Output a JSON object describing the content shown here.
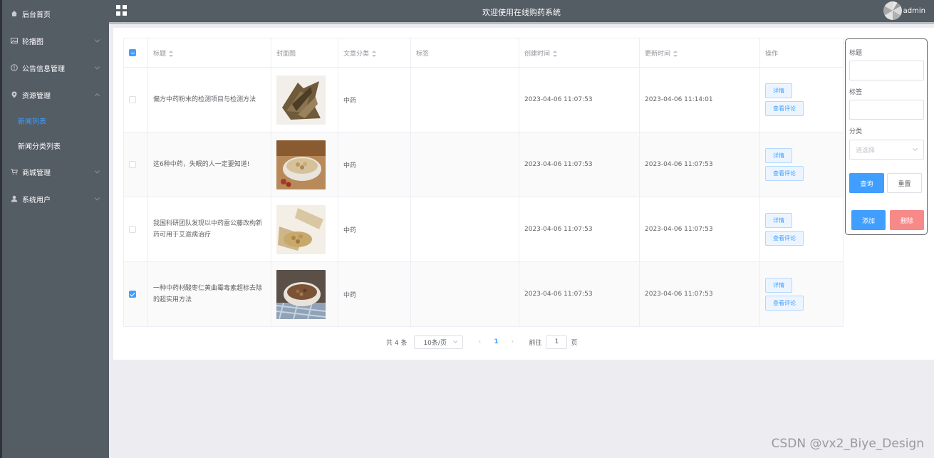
{
  "header": {
    "title": "欢迎使用在线购药系统",
    "user": "admin"
  },
  "sidebar": {
    "items": [
      {
        "label": "后台首页",
        "icon": "home-icon"
      },
      {
        "label": "轮播图",
        "icon": "picture-icon"
      },
      {
        "label": "公告信息管理",
        "icon": "info-icon"
      },
      {
        "label": "资源管理",
        "icon": "location-icon"
      },
      {
        "label": "商城管理",
        "icon": "cart-icon"
      },
      {
        "label": "系统用户",
        "icon": "user-icon"
      }
    ],
    "subitems": [
      {
        "label": "新闻列表",
        "active": true
      },
      {
        "label": "新闻分类列表",
        "active": false
      }
    ]
  },
  "table": {
    "columns": {
      "title": "标题",
      "cover": "封面图",
      "category": "文章分类",
      "tags": "标签",
      "created": "创建时间",
      "updated": "更新时间",
      "actions": "操作"
    },
    "rows": [
      {
        "title": "偏方中药粉末的检测项目与检测方法",
        "category": "中药",
        "tags": "",
        "created": "2023-04-06 11:07:53",
        "updated": "2023-04-06 11:14:01",
        "checked": false
      },
      {
        "title": "这6种中药，失眠的人一定要知道!",
        "category": "中药",
        "tags": "",
        "created": "2023-04-06 11:07:53",
        "updated": "2023-04-06 11:07:53",
        "checked": false
      },
      {
        "title": "我国科研团队发现以中药雷公藤改构新药可用于艾滋病治疗",
        "category": "中药",
        "tags": "",
        "created": "2023-04-06 11:07:53",
        "updated": "2023-04-06 11:07:53",
        "checked": false
      },
      {
        "title": "一种中药材酸枣仁黄曲霉毒素超标去除的超实用方法",
        "category": "中药",
        "tags": "",
        "created": "2023-04-06 11:07:53",
        "updated": "2023-04-06 11:07:53",
        "checked": true
      }
    ],
    "detail_label": "详情",
    "comments_label": "查看评论"
  },
  "pagination": {
    "total": "共 4 条",
    "page_size": "10条/页",
    "prev": "‹",
    "current_page": "1",
    "next": "›",
    "goto_prefix": "前往",
    "goto_value": "1",
    "goto_suffix": "页"
  },
  "search": {
    "title_label": "标题",
    "title_value": "",
    "tags_label": "标签",
    "tags_value": "",
    "category_label": "分类",
    "category_placeholder": "请选择",
    "query_label": "查询",
    "reset_label": "重置",
    "add_label": "添加",
    "delete_label": "删除"
  },
  "watermark": "CSDN @vx2_Biye_Design",
  "colors": {
    "sidebar_bg": "#545c64",
    "primary": "#409eff",
    "danger": "#f78989"
  }
}
